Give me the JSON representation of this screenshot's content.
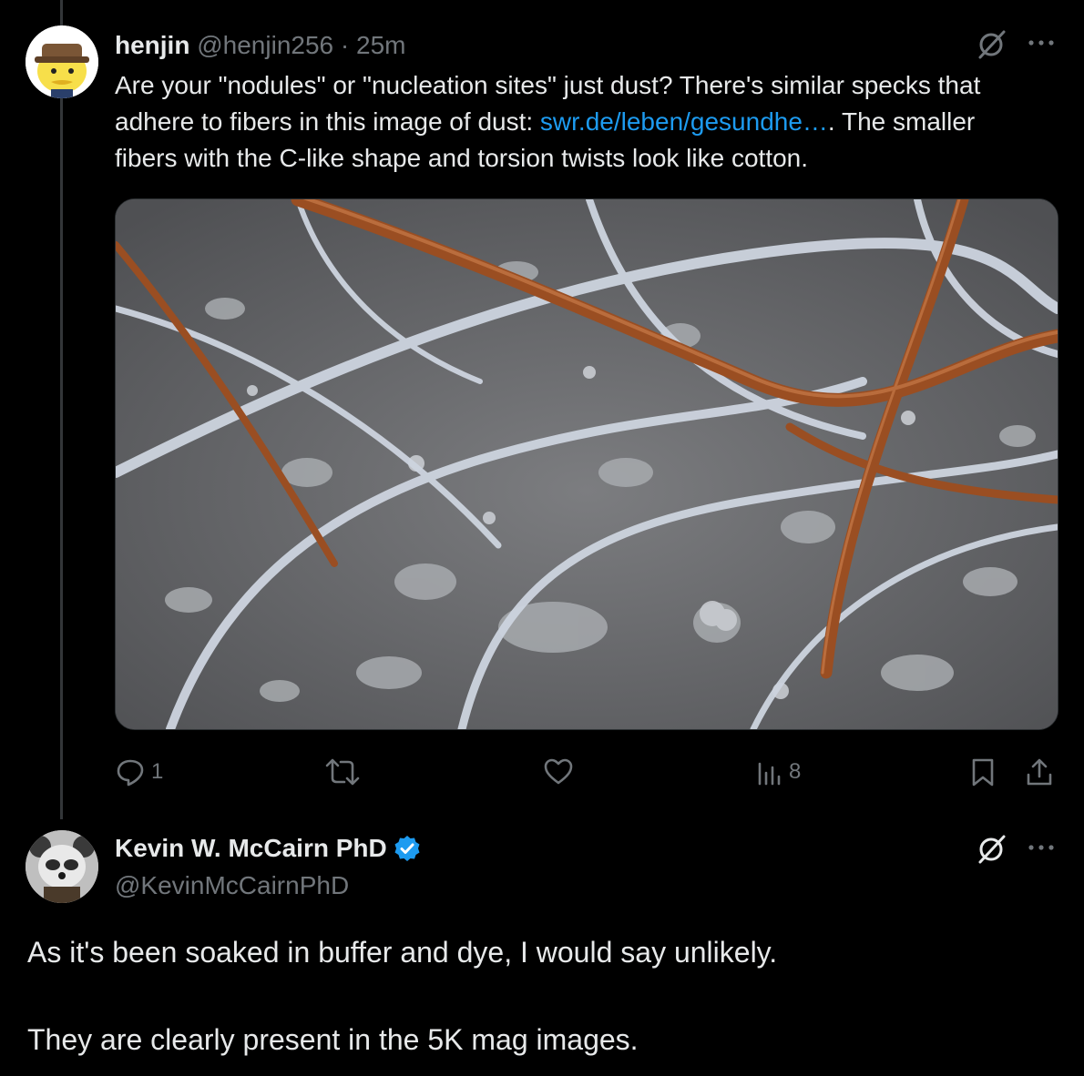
{
  "post1": {
    "author_name": "henjin",
    "author_handle": "@henjin256",
    "separator": "·",
    "time": "25m",
    "text_part1": "Are your \"nodules\" or \"nucleation sites\" just dust? There's similar specks that adhere to fibers in this image of dust: ",
    "link_text": "swr.de/leben/gesundhe…",
    "text_part2": ". The smaller fibers with the C-like shape and torsion twists look like cotton.",
    "actions": {
      "replies": "1",
      "reposts": "",
      "likes": "",
      "views": "8"
    }
  },
  "post2": {
    "author_name": "Kevin W. McCairn PhD",
    "author_handle": "@KevinMcCairnPhD",
    "verified": true,
    "paragraph1": "As it's been soaked in buffer and dye, I would say unlikely.",
    "paragraph2": "They are clearly present in the 5K mag images."
  },
  "colors": {
    "background": "#000000",
    "text": "#e7e9ea",
    "muted": "#71767b",
    "link": "#1d9bf0",
    "verified": "#1d9bf0"
  },
  "icons": {
    "reply": "reply-icon",
    "repost": "repost-icon",
    "like": "heart-icon",
    "views": "views-icon",
    "bookmark": "bookmark-icon",
    "share": "share-icon",
    "grok": "grok-icon",
    "more": "more-icon",
    "verified": "verified-badge-icon"
  }
}
